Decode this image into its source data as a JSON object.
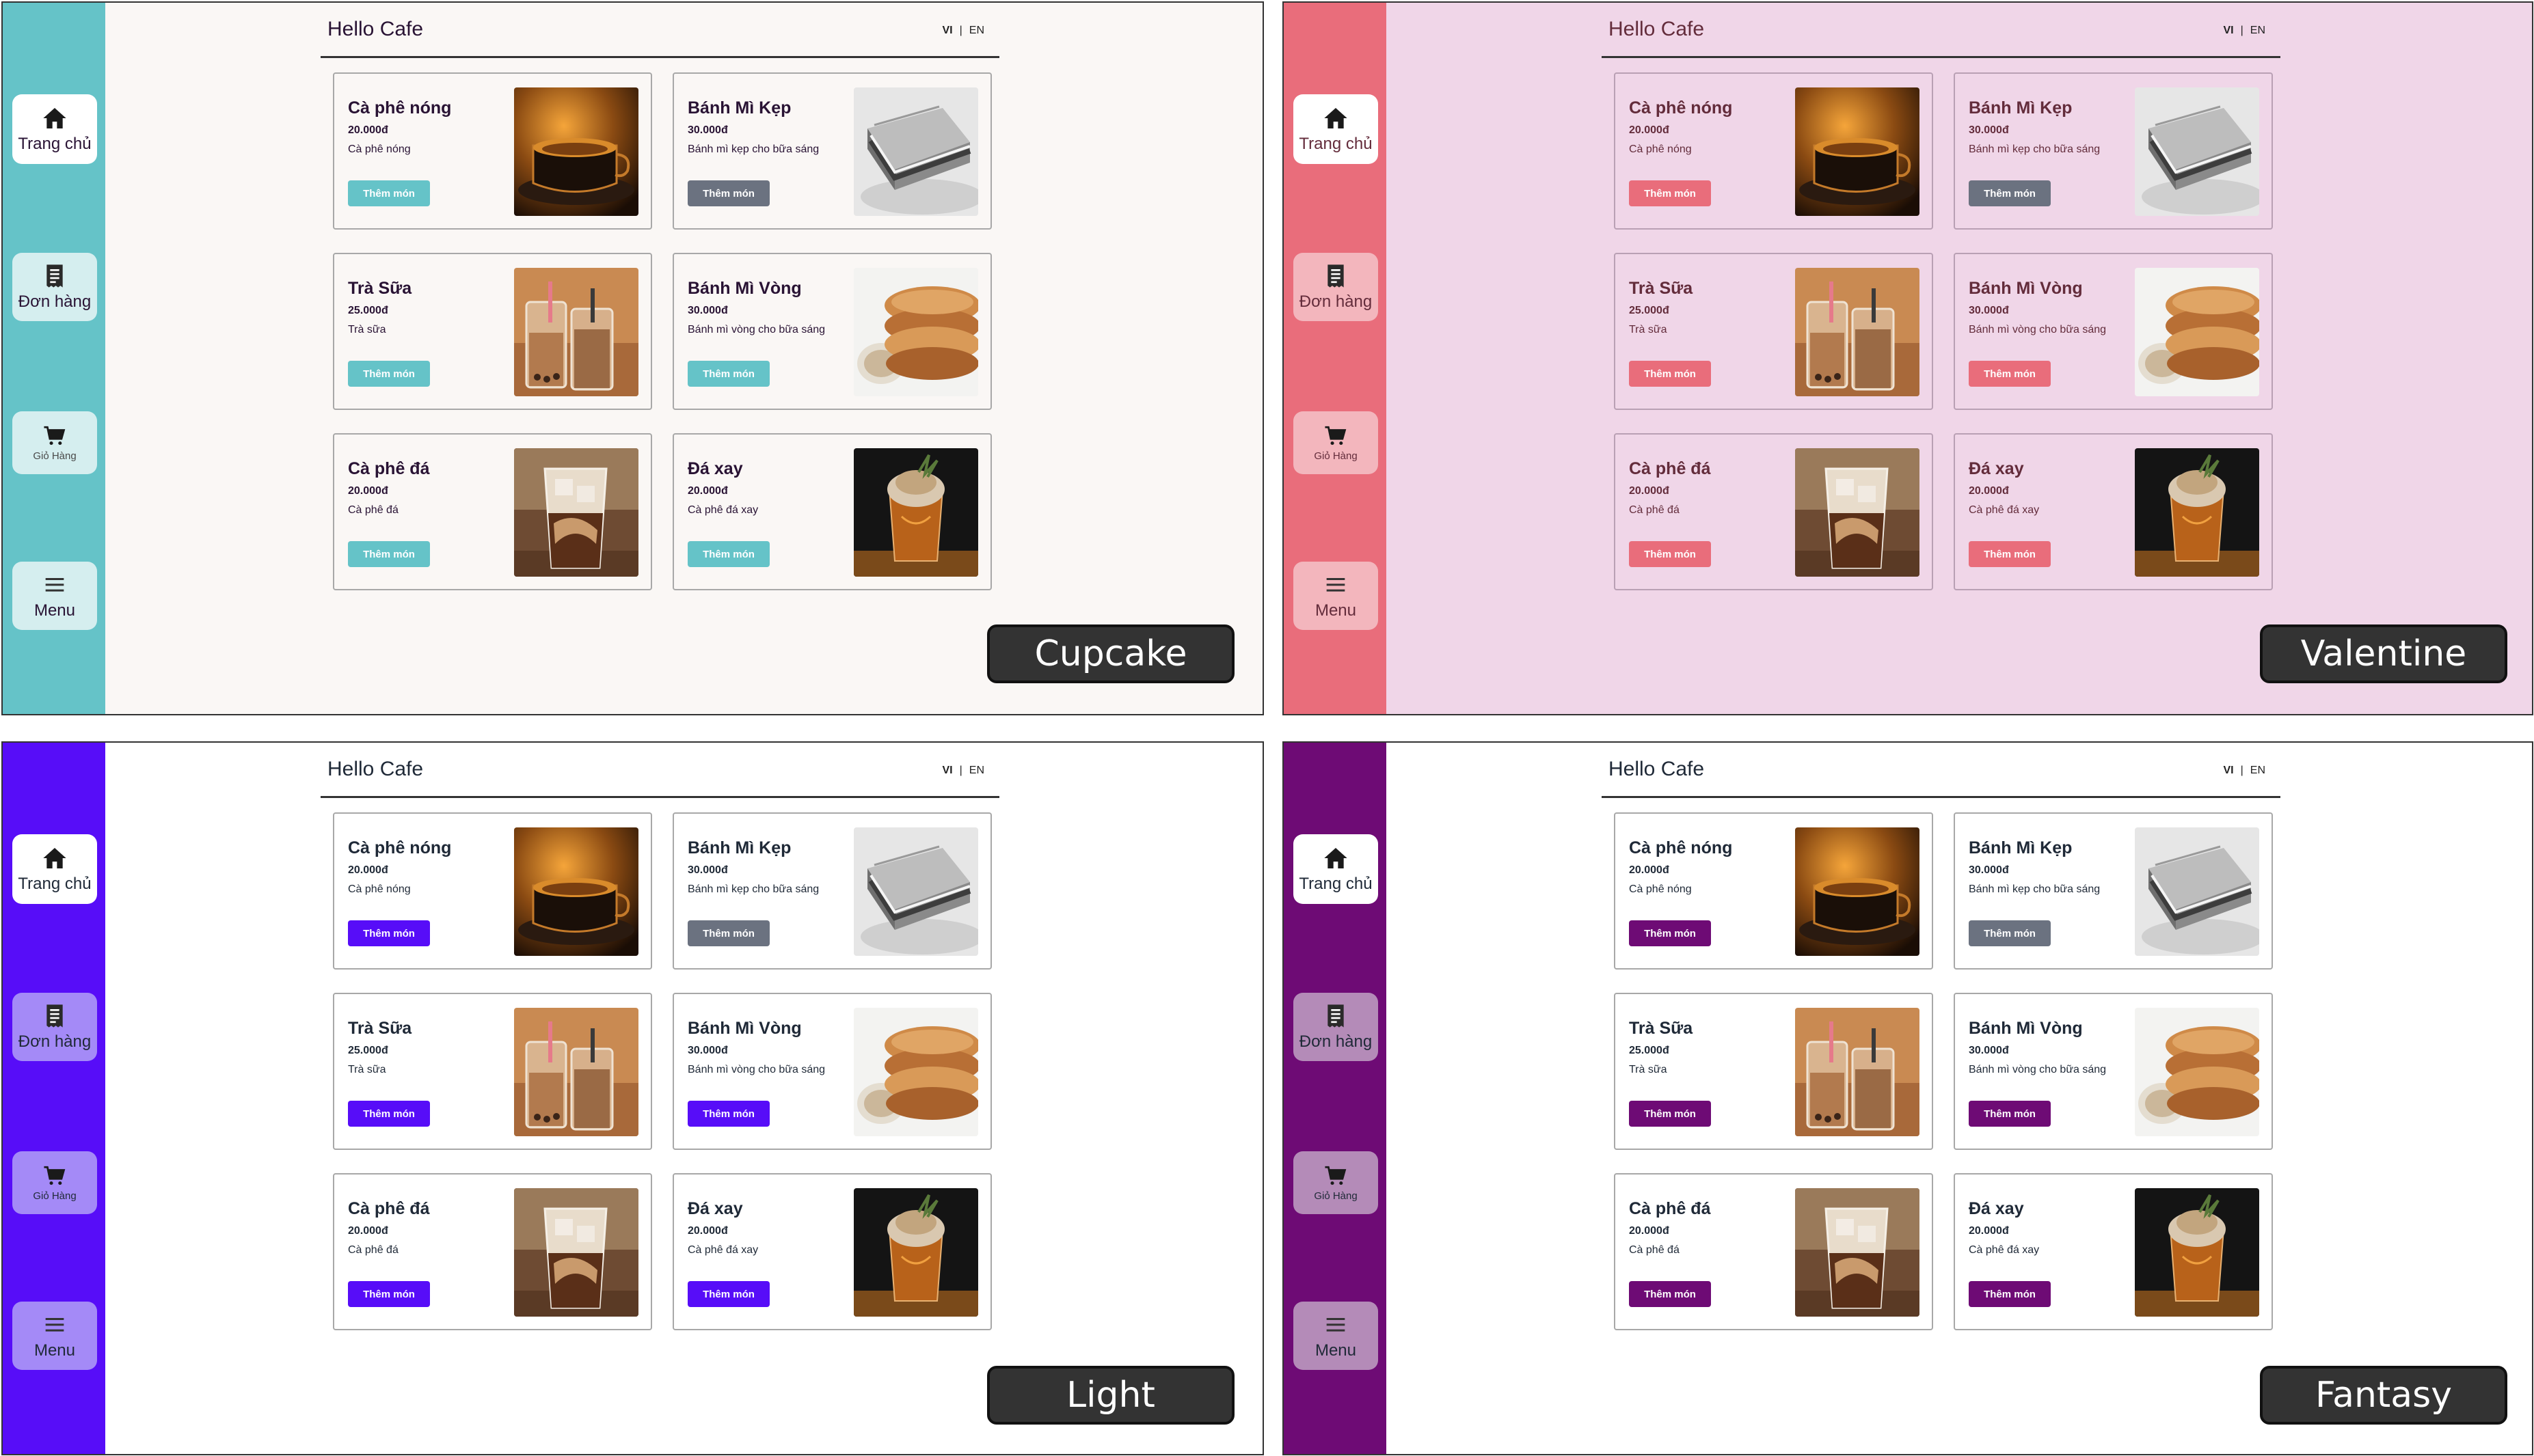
{
  "app": {
    "title": "Hello Cafe",
    "lang_vi": "VI",
    "lang_sep": "|",
    "lang_en": "EN"
  },
  "nav": [
    {
      "label": "Trang chủ",
      "icon": "home-icon"
    },
    {
      "label": "Đơn hàng",
      "icon": "receipt-icon"
    },
    {
      "label": "Giỏ Hàng",
      "icon": "cart-icon"
    },
    {
      "label": "Menu",
      "icon": "menu-icon"
    }
  ],
  "products": [
    {
      "name": "Cà phê nóng",
      "price": "20.000đ",
      "desc": "Cà phê nóng",
      "button": "Thêm món",
      "image": "hot-coffee-image"
    },
    {
      "name": "Bánh Mì Kẹp",
      "price": "30.000đ",
      "desc": "Bánh mì kẹp cho bữa sáng",
      "button": "Thêm món",
      "image": "sandwich-image",
      "button_muted": true
    },
    {
      "name": "Trà Sữa",
      "price": "25.000đ",
      "desc": "Trà sữa",
      "button": "Thêm món",
      "image": "milk-tea-image"
    },
    {
      "name": "Bánh Mì Vòng",
      "price": "30.000đ",
      "desc": "Bánh mì vòng cho bữa sáng",
      "button": "Thêm món",
      "image": "bagel-image"
    },
    {
      "name": "Cà phê đá",
      "price": "20.000đ",
      "desc": "Cà phê đá",
      "button": "Thêm món",
      "image": "iced-coffee-image"
    },
    {
      "name": "Đá xay",
      "price": "20.000đ",
      "desc": "Cà phê đá xay",
      "button": "Thêm món",
      "image": "frappe-image"
    }
  ],
  "themes": [
    {
      "name": "Cupcake",
      "sidebar": "#65c3c8",
      "page": "#faf7f5",
      "primary": "#65c3c8",
      "muted": "#6b7280",
      "card_border": "#a8a8a8",
      "text": "#291334",
      "nav_active_bg": "#ffffff",
      "nav_bg": "#d5eeef",
      "nav_text": "#291334",
      "nav_small_text": "#4a4a4a"
    },
    {
      "name": "Valentine",
      "sidebar": "#e96d7b",
      "page": "#f0d6e8",
      "primary": "#e96d7b",
      "muted": "#6b7280",
      "card_border": "#b9a0b4",
      "text": "#632c3b",
      "nav_active_bg": "#ffffff",
      "nav_bg": "#f3b6bd",
      "nav_text": "#632c3b",
      "nav_small_text": "#632c3b"
    },
    {
      "name": "Light",
      "sidebar": "#570df8",
      "page": "#ffffff",
      "primary": "#570df8",
      "muted": "#6b7280",
      "card_border": "#a8a8a8",
      "text": "#1f2937",
      "nav_active_bg": "#ffffff",
      "nav_bg": "#a48af7",
      "nav_text": "#1f2937",
      "nav_small_text": "#1f2937"
    },
    {
      "name": "Fantasy",
      "sidebar": "#6e0b75",
      "page": "#ffffff",
      "primary": "#6e0b75",
      "muted": "#6b7280",
      "card_border": "#a8a8a8",
      "text": "#1f2937",
      "nav_active_bg": "#ffffff",
      "nav_bg": "#b48bb8",
      "nav_text": "#1f2937",
      "nav_small_text": "#1f2937"
    }
  ]
}
